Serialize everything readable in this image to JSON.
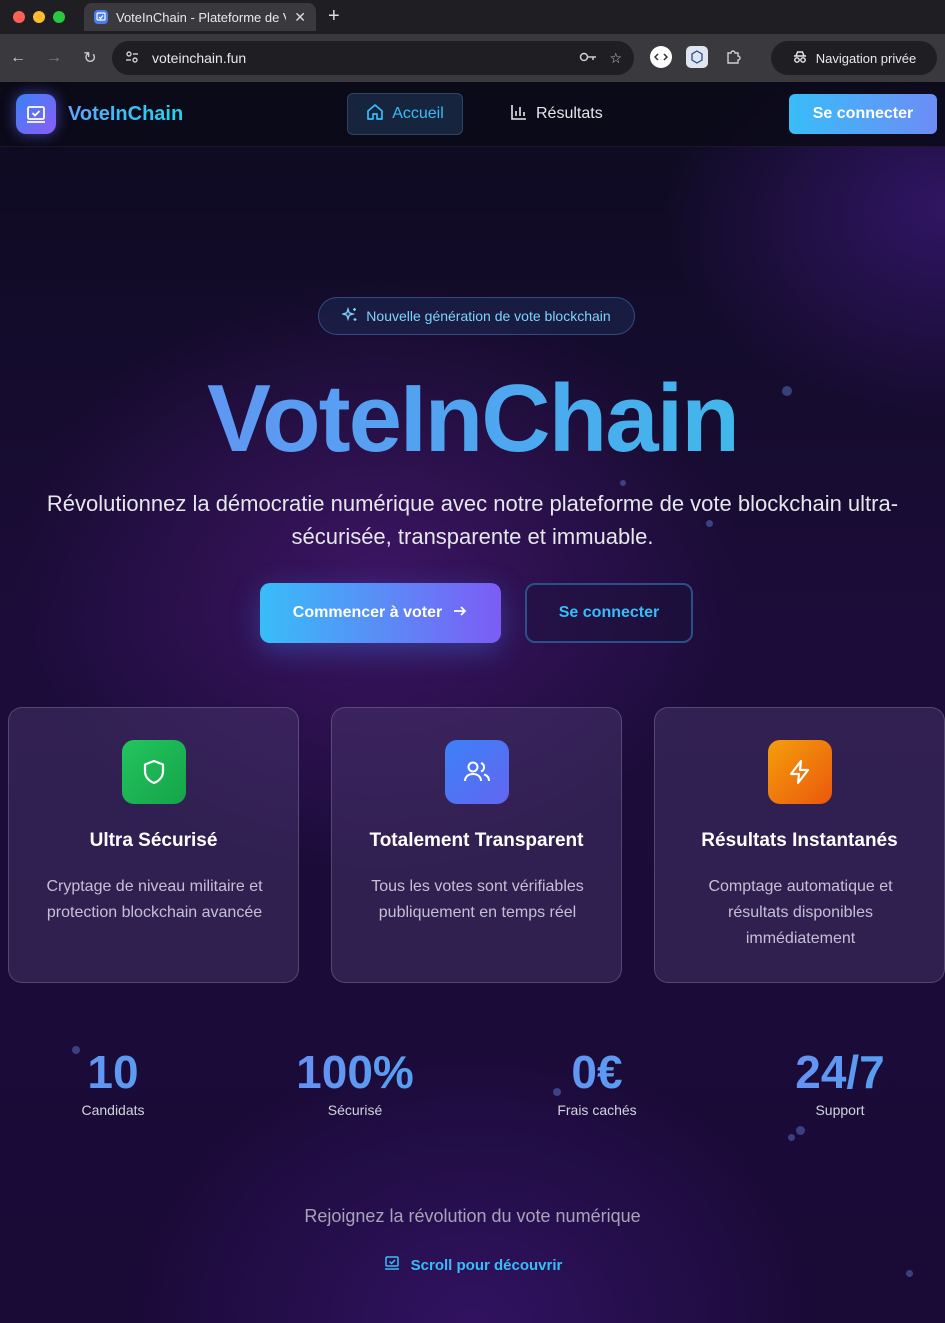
{
  "browser": {
    "tab_title": "VoteInChain - Plateforme de V",
    "url": "voteinchain.fun",
    "private_label": "Navigation privée"
  },
  "nav": {
    "brand": "VoteInChain",
    "home_label": "Accueil",
    "results_label": "Résultats",
    "login_label": "Se connecter"
  },
  "hero": {
    "badge": "Nouvelle génération de vote blockchain",
    "title": "VoteInChain",
    "subtitle": "Révolutionnez la démocratie numérique avec notre plateforme de vote blockchain ultra-sécurisée, transparente et immuable.",
    "cta_primary": "Commencer à voter",
    "cta_secondary": "Se connecter"
  },
  "features": [
    {
      "title": "Ultra Sécurisé",
      "description": "Cryptage de niveau militaire et protection blockchain avancée",
      "icon": "shield-icon",
      "color_from": "#22c55e",
      "color_to": "#16a34a"
    },
    {
      "title": "Totalement Transparent",
      "description": "Tous les votes sont vérifiables publiquement en temps réel",
      "icon": "users-icon",
      "color_from": "#3b82f6",
      "color_to": "#6366f1"
    },
    {
      "title": "Résultats Instantanés",
      "description": "Comptage automatique et résultats disponibles immédiatement",
      "icon": "lightning-icon",
      "color_from": "#f59e0b",
      "color_to": "#ea580c"
    }
  ],
  "stats": [
    {
      "value": "10",
      "label": "Candidats"
    },
    {
      "value": "100%",
      "label": "Sécurisé"
    },
    {
      "value": "0€",
      "label": "Frais cachés"
    },
    {
      "value": "24/7",
      "label": "Support"
    }
  ],
  "footer": {
    "tagline": "Rejoignez la révolution du vote numérique",
    "scroll_label": "Scroll pour découvrir"
  },
  "colors": {
    "accent": "#38bdf8",
    "gradient_start": "#6d8cf5",
    "gradient_end": "#38c6e8"
  }
}
